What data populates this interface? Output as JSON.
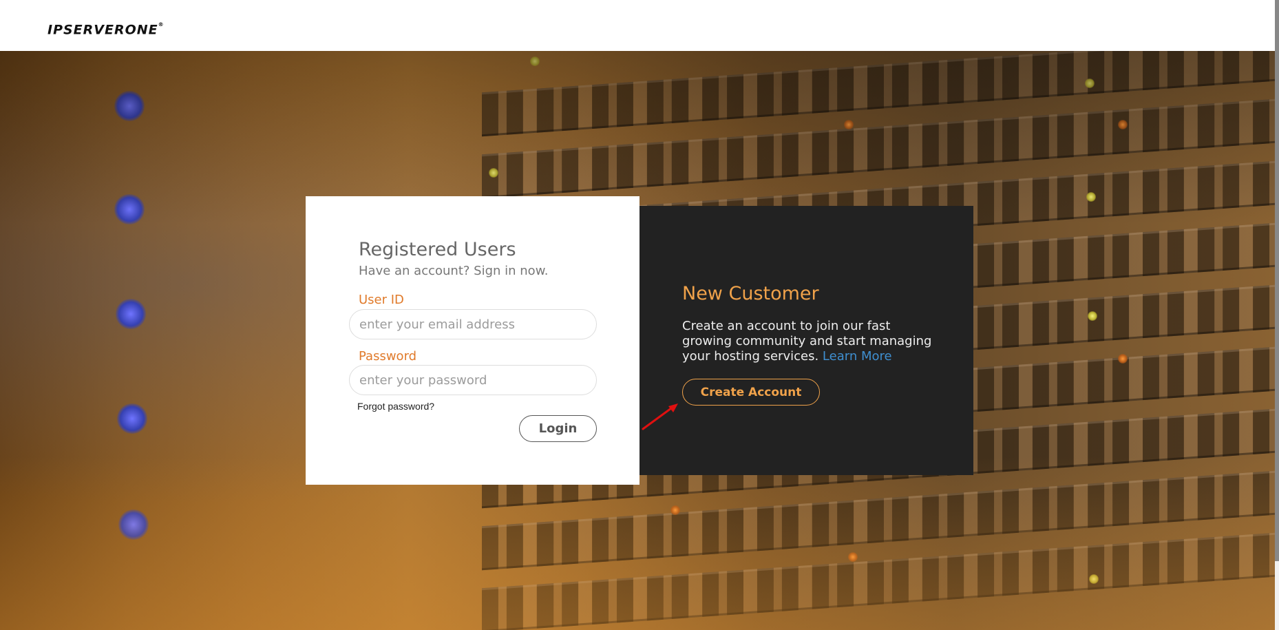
{
  "header": {
    "logo_text": "IPSERVERONE",
    "logo_mark": "®"
  },
  "login": {
    "title": "Registered Users",
    "subtitle": "Have an account? Sign in now.",
    "user_id_label": "User ID",
    "user_id_placeholder": "enter your email address",
    "user_id_value": "",
    "password_label": "Password",
    "password_placeholder": "enter your password",
    "password_value": "",
    "forgot_label": "Forgot password?",
    "login_button": "Login"
  },
  "new_customer": {
    "title": "New Customer",
    "description": "Create an account to join our fast growing community and start managing your hosting services.",
    "learn_more": "Learn More",
    "create_button": "Create Account"
  },
  "colors": {
    "accent": "#e07a2a",
    "accent_light": "#f0a24a",
    "link": "#3f8fd0",
    "panel_dark": "#222222",
    "annotation_arrow": "#e01010"
  }
}
